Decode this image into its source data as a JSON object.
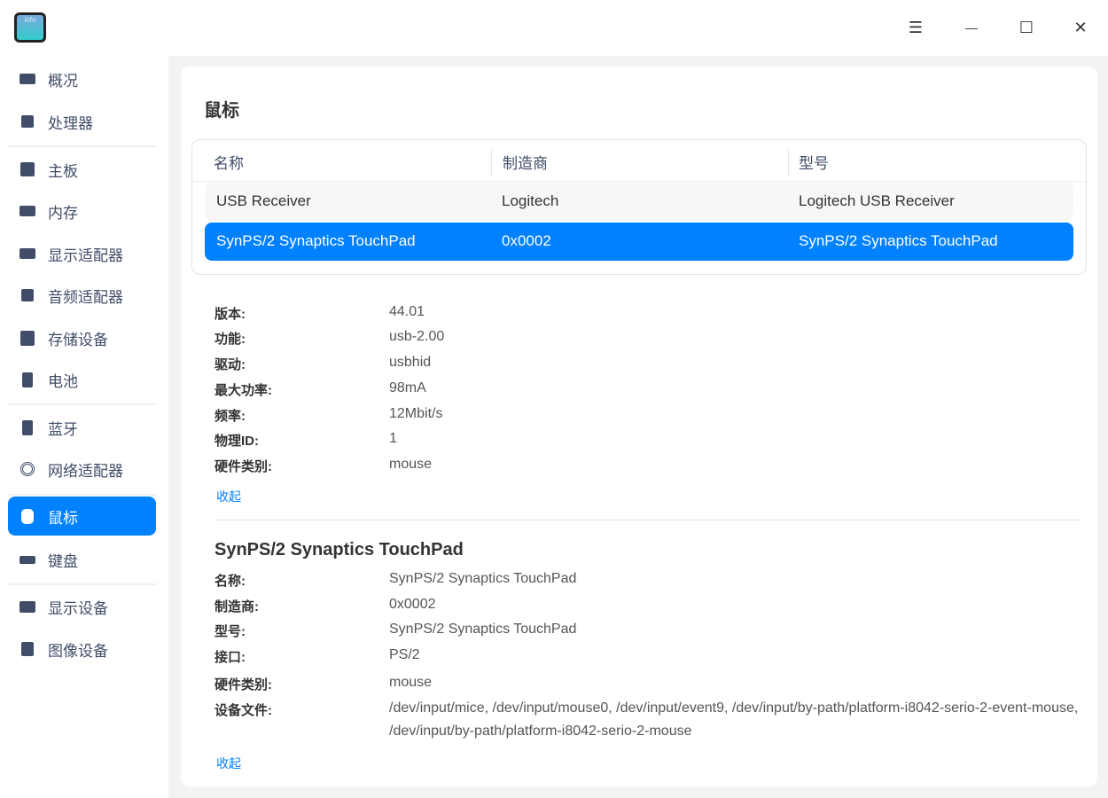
{
  "window": {
    "menu_icon": "☰",
    "minimize_icon": "—",
    "maximize_icon": "☐",
    "close_icon": "✕",
    "logo_text": "info"
  },
  "sidebar": {
    "items": [
      {
        "label": "概况",
        "icon": "computer-icon"
      },
      {
        "label": "处理器",
        "icon": "cpu-icon"
      },
      {
        "label": "主板",
        "icon": "motherboard-icon"
      },
      {
        "label": "内存",
        "icon": "memory-icon"
      },
      {
        "label": "显示适配器",
        "icon": "gpu-icon"
      },
      {
        "label": "音频适配器",
        "icon": "speaker-icon"
      },
      {
        "label": "存储设备",
        "icon": "disk-icon"
      },
      {
        "label": "电池",
        "icon": "battery-icon"
      },
      {
        "label": "蓝牙",
        "icon": "bluetooth-icon"
      },
      {
        "label": "网络适配器",
        "icon": "network-icon"
      },
      {
        "label": "鼠标",
        "icon": "mouse-icon"
      },
      {
        "label": "键盘",
        "icon": "keyboard-icon"
      },
      {
        "label": "显示设备",
        "icon": "monitor-icon"
      },
      {
        "label": "图像设备",
        "icon": "camera-icon"
      }
    ],
    "selected": "鼠标"
  },
  "main": {
    "title": "鼠标",
    "table": {
      "headers": [
        "名称",
        "制造商",
        "型号"
      ],
      "rows": [
        [
          "USB Receiver",
          "Logitech",
          "Logitech USB Receiver"
        ],
        [
          "SynPS/2 Synaptics TouchPad",
          "0x0002",
          "SynPS/2 Synaptics TouchPad"
        ]
      ]
    },
    "details1": [
      {
        "label": "版本:",
        "value": "44.01"
      },
      {
        "label": "功能:",
        "value": "usb-2.00"
      },
      {
        "label": "驱动:",
        "value": "usbhid"
      },
      {
        "label": "最大功率:",
        "value": "98mA"
      },
      {
        "label": "频率:",
        "value": "12Mbit/s"
      },
      {
        "label": "物理ID:",
        "value": "1"
      },
      {
        "label": "硬件类别:",
        "value": "mouse"
      }
    ],
    "collapse1": "收起",
    "section2_title": "SynPS/2 Synaptics TouchPad",
    "details2": [
      {
        "label": "名称:",
        "value": "SynPS/2 Synaptics TouchPad"
      },
      {
        "label": "制造商:",
        "value": "0x0002"
      },
      {
        "label": "型号:",
        "value": "SynPS/2 Synaptics TouchPad"
      },
      {
        "label": "接口:",
        "value": "PS/2"
      },
      {
        "label": "硬件类别:",
        "value": "mouse"
      },
      {
        "label": "设备文件:",
        "value": "/dev/input/mice, /dev/input/mouse0, /dev/input/event9, /dev/input/by-path/platform-i8042-serio-2-event-mouse, /dev/input/by-path/platform-i8042-serio-2-mouse"
      }
    ],
    "collapse2": "收起"
  },
  "colors": {
    "accent": "#0081ff",
    "text": "#414d68"
  }
}
